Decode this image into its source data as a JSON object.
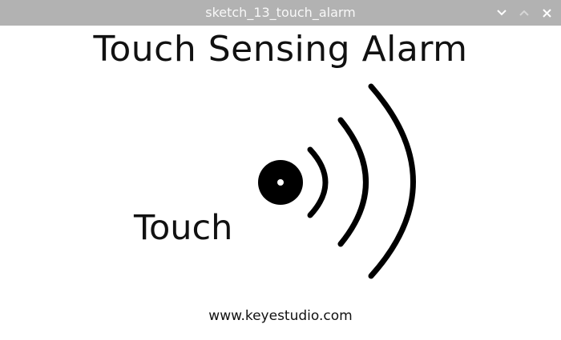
{
  "window": {
    "title": "sketch_13_touch_alarm",
    "titlebar_color": "#b2b2b2",
    "controls": [
      {
        "name": "minimize",
        "icon": "chevron-down-icon"
      },
      {
        "name": "maximize",
        "icon": "chevron-up-icon"
      },
      {
        "name": "close",
        "icon": "close-icon"
      }
    ]
  },
  "sketch": {
    "heading": "Touch Sensing Alarm",
    "touch_label": "Touch",
    "footer": "www.keyestudio.com",
    "signal_icon": "touch-signal-icon",
    "ink_color": "#000000",
    "background": "#ffffff"
  }
}
